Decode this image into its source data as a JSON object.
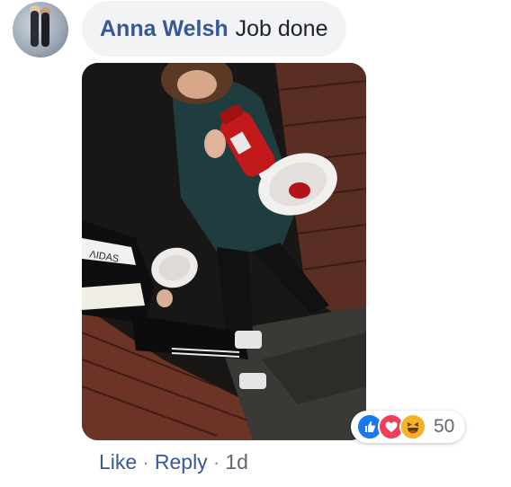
{
  "comment": {
    "author": "Anna Welsh",
    "text": "Job done",
    "avatar_icon": "avatar-photo"
  },
  "attachment": {
    "icon": "photo-image",
    "description": ""
  },
  "reactions": {
    "icons": [
      "like-icon",
      "love-icon",
      "haha-icon"
    ],
    "count": "50",
    "colors": {
      "like": "#1877f2",
      "love": "#f33e58",
      "haha": "#f7b125"
    }
  },
  "actions": {
    "like_label": "Like",
    "reply_label": "Reply",
    "timestamp": "1d",
    "separator": "·"
  },
  "colors": {
    "link": "#385898",
    "bubble_bg": "#f2f3f5",
    "meta": "#606770"
  }
}
